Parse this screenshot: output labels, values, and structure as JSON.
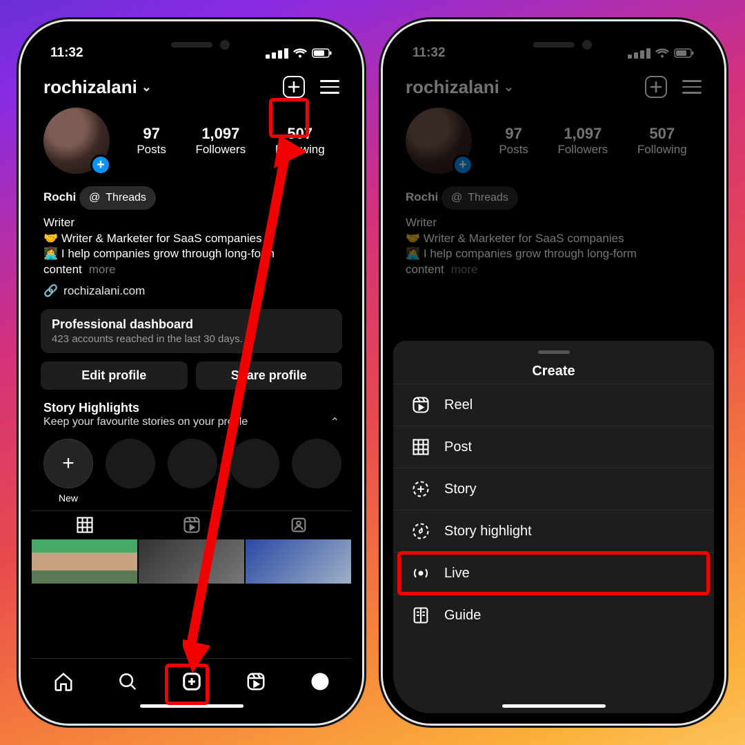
{
  "status": {
    "time": "11:32"
  },
  "profile": {
    "username": "rochizalani",
    "name": "Rochi",
    "stats": {
      "posts": {
        "value": "97",
        "label": "Posts"
      },
      "followers": {
        "value": "1,097",
        "label": "Followers"
      },
      "following": {
        "value": "507",
        "label": "Following"
      }
    },
    "threads_label": "Threads",
    "bio_category": "Writer",
    "bio_line1": "🤝 Writer & Marketer for SaaS companies",
    "bio_line2": "👩‍💻 I help companies grow through long-form content",
    "more_label": "more",
    "link": "rochizalani.com"
  },
  "dashboard": {
    "title": "Professional dashboard",
    "subtitle": "423 accounts reached in the last 30 days."
  },
  "buttons": {
    "edit": "Edit profile",
    "share": "Share profile"
  },
  "highlights": {
    "title": "Story Highlights",
    "subtitle": "Keep your favourite stories on your profile",
    "new_label": "New"
  },
  "create_sheet": {
    "title": "Create",
    "items": {
      "reel": "Reel",
      "post": "Post",
      "story": "Story",
      "story_highlight": "Story highlight",
      "live": "Live",
      "guide": "Guide"
    }
  }
}
